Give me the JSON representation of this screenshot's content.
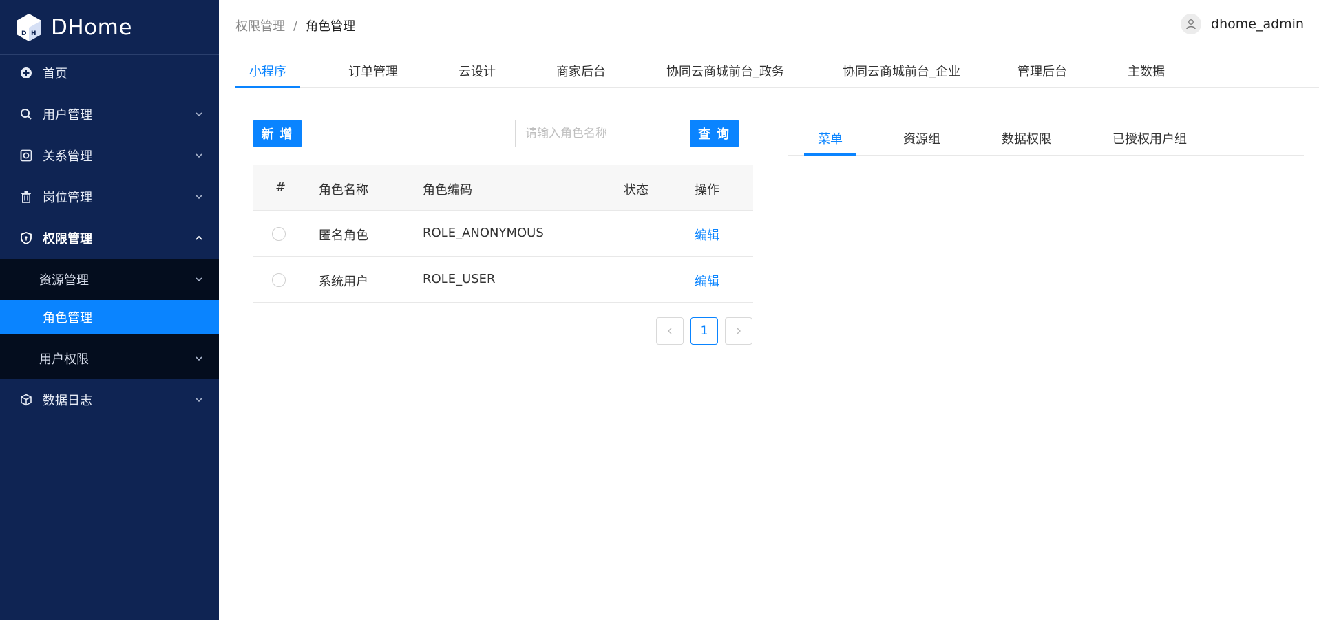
{
  "app": {
    "name": "DHome"
  },
  "sidebar": {
    "items": [
      {
        "label": "首页"
      },
      {
        "label": "用户管理"
      },
      {
        "label": "关系管理"
      },
      {
        "label": "岗位管理"
      },
      {
        "label": "权限管理"
      },
      {
        "label": "数据日志"
      }
    ],
    "subitems": [
      {
        "label": "资源管理"
      },
      {
        "label": "角色管理"
      },
      {
        "label": "用户权限"
      }
    ]
  },
  "breadcrumb": {
    "parent": "权限管理",
    "separator": "/",
    "current": "角色管理"
  },
  "user": {
    "name": "dhome_admin"
  },
  "app_tabs": [
    "小程序",
    "订单管理",
    "云设计",
    "商家后台",
    "协同云商城前台_政务",
    "协同云商城前台_企业",
    "管理后台",
    "主数据"
  ],
  "toolbar": {
    "add_label": "新 增",
    "search_placeholder": "请输入角色名称",
    "search_label": "查 询"
  },
  "table": {
    "headers": [
      "#",
      "角色名称",
      "角色编码",
      "状态",
      "操作"
    ],
    "rows": [
      {
        "name": "匿名角色",
        "code": "ROLE_ANONYMOUS",
        "status": "",
        "action": "编辑"
      },
      {
        "name": "系统用户",
        "code": "ROLE_USER",
        "status": "",
        "action": "编辑"
      }
    ]
  },
  "pagination": {
    "prev": "<",
    "current": "1",
    "next": ">"
  },
  "right_tabs": [
    "菜单",
    "资源组",
    "数据权限",
    "已授权用户组"
  ],
  "colors": {
    "sidebar_bg": "#0f2453",
    "accent": "#0a84ff"
  }
}
